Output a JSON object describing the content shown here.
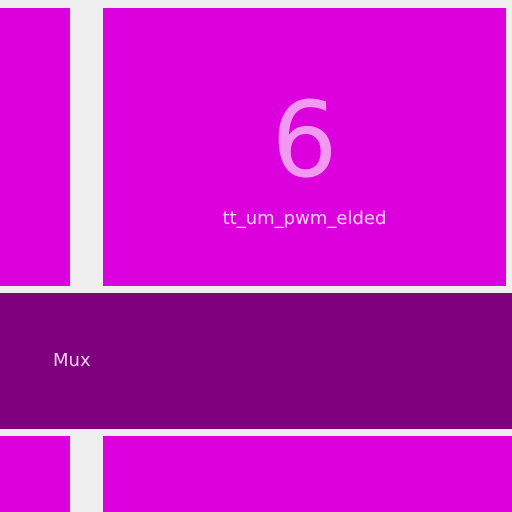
{
  "tiles": {
    "main": {
      "number": "6",
      "label": "tt_um_pwm_elded"
    }
  },
  "band": {
    "label": "Mux"
  },
  "colors": {
    "background": "#efefef",
    "tile": "#dc00dc",
    "band": "#7e007e",
    "number": "#f29af2",
    "label": "#f7d5f7"
  }
}
